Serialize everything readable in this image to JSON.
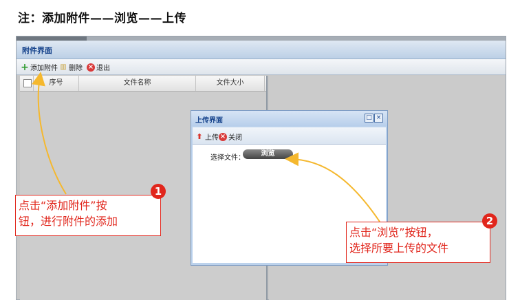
{
  "note": "注：添加附件——浏览——上传",
  "panel": {
    "title": "附件界面"
  },
  "toolbar": {
    "add_label": "添加附件",
    "delete_label": "删除",
    "exit_label": "退出"
  },
  "grid": {
    "columns": [
      "序号",
      "文件名称",
      "文件大小"
    ]
  },
  "dialog": {
    "title": "上传界面",
    "upload_label": "上传",
    "close_label": "关闭",
    "file_label": "选择文件：",
    "browse_label": "浏览"
  },
  "callouts": [
    {
      "number": "1",
      "text_line1": "点击“添加附件”按",
      "text_line2": "钮，进行附件的添加"
    },
    {
      "number": "2",
      "text_line1": "点击“浏览”按钮，",
      "text_line2": "选择所要上传的文件"
    }
  ],
  "colors": {
    "callout_red": "#e1261c",
    "arrow_yellow": "#f5b82e",
    "panel_title_blue": "#15428b"
  }
}
